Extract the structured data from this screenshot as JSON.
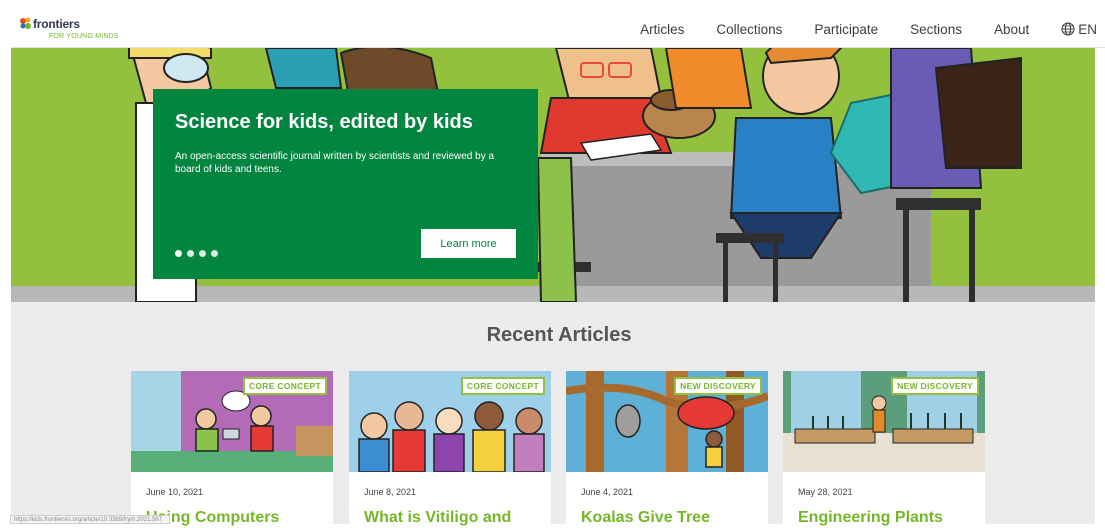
{
  "brand": {
    "name": "frontiers",
    "subtitle": "FOR YOUNG MINDS"
  },
  "nav": {
    "items": [
      "Articles",
      "Collections",
      "Participate",
      "Sections",
      "About"
    ],
    "language": "EN"
  },
  "hero": {
    "title": "Science for kids, edited by kids",
    "description": "An open-access scientific journal written by scientists and reviewed by a board of kids and teens.",
    "button_label": "Learn more",
    "slides": 4,
    "active_slide": 1
  },
  "recent": {
    "heading": "Recent Articles",
    "articles": [
      {
        "badge": "CORE CONCEPT",
        "date": "June 10, 2021",
        "title": "Using Computers"
      },
      {
        "badge": "CORE CONCEPT",
        "date": "June 8, 2021",
        "title": "What is Vitiligo and"
      },
      {
        "badge": "NEW DISCOVERY",
        "date": "June 4, 2021",
        "title": "Koalas Give Tree"
      },
      {
        "badge": "NEW DISCOVERY",
        "date": "May 28, 2021",
        "title": "Engineering Plants"
      }
    ]
  },
  "status_bar": {
    "url": "https://kids.frontiersin.org/article/10.3389/frym.2021.567"
  },
  "colors": {
    "brand_green": "#02853f",
    "hero_bg": "#94c13d",
    "accent_green": "#76b72a"
  }
}
